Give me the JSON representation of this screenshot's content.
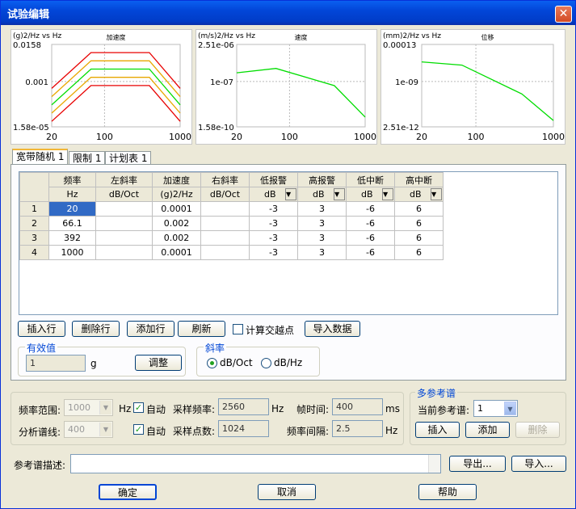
{
  "window": {
    "title": "试验编辑",
    "close_glyph": "✕"
  },
  "charts": [
    {
      "ylabel": "(g)2/Hz vs Hz",
      "title": "加速度",
      "y_top": "0.0158",
      "y_mid": "0.001",
      "y_bot": "1.58e-05",
      "x_ticks": [
        "20",
        "100",
        "1000"
      ]
    },
    {
      "ylabel": "(m/s)2/Hz vs Hz",
      "title": "速度",
      "y_top": "2.51e-06",
      "y_mid": "1e-07",
      "y_bot": "1.58e-10",
      "x_ticks": [
        "20",
        "100",
        "1000"
      ]
    },
    {
      "ylabel": "(mm)2/Hz vs Hz",
      "title": "位移",
      "y_top": "0.00013",
      "y_mid": "1e-09",
      "y_bot": "2.51e-12",
      "x_ticks": [
        "20",
        "100",
        "1000"
      ]
    }
  ],
  "chart_data": [
    {
      "type": "line",
      "x": [
        20,
        66.1,
        392,
        1000
      ],
      "title": "加速度",
      "xlabel": "",
      "ylabel": "(g)2/Hz vs Hz",
      "series": [
        {
          "values": [
            0.0001,
            0.002,
            0.002,
            0.0001
          ]
        }
      ],
      "colors": {
        "profile": "#00dd00",
        "warning": "#e8a800",
        "abort": "#e80000"
      }
    },
    {
      "type": "line",
      "x": [
        20,
        66.1,
        392,
        1000
      ],
      "title": "速度",
      "series": [
        {
          "values": [
            9e-08,
            1.5e-07,
            2e-08,
            5e-10
          ]
        }
      ]
    },
    {
      "type": "line",
      "x": [
        20,
        66.1,
        392,
        1000
      ],
      "title": "位移",
      "series": [
        {
          "values": [
            3e-06,
            1.5e-06,
            3e-09,
            1e-11
          ]
        }
      ]
    }
  ],
  "tabs": [
    {
      "label": "宽带随机 1"
    },
    {
      "label": "限制 1"
    },
    {
      "label": "计划表 1"
    }
  ],
  "table": {
    "headers": [
      "频率",
      "左斜率",
      "加速度",
      "右斜率",
      "低报警",
      "高报警",
      "低中断",
      "高中断"
    ],
    "units": [
      "Hz",
      "dB/Oct",
      "(g)2/Hz",
      "dB/Oct",
      "dB",
      "dB",
      "dB",
      "dB"
    ],
    "rows": [
      {
        "n": "1",
        "cells": [
          "20",
          "",
          "0.0001",
          "",
          "-3",
          "3",
          "-6",
          "6"
        ]
      },
      {
        "n": "2",
        "cells": [
          "66.1",
          "",
          "0.002",
          "",
          "-3",
          "3",
          "-6",
          "6"
        ]
      },
      {
        "n": "3",
        "cells": [
          "392",
          "",
          "0.002",
          "",
          "-3",
          "3",
          "-6",
          "6"
        ]
      },
      {
        "n": "4",
        "cells": [
          "1000",
          "",
          "0.0001",
          "",
          "-3",
          "3",
          "-6",
          "6"
        ]
      }
    ],
    "dropdown_glyph": "▼"
  },
  "toolbar": {
    "insert_row": "插入行",
    "delete_row": "删除行",
    "add_row": "添加行",
    "refresh": "刷新",
    "calc_cross": "计算交越点",
    "import_data": "导入数据"
  },
  "rms": {
    "group": "有效值",
    "value": "1",
    "unit": "g",
    "adjust": "调整"
  },
  "slope": {
    "group": "斜率",
    "opt1": "dB/Oct",
    "opt2": "dB/Hz"
  },
  "params": {
    "freq_range_label": "频率范围:",
    "freq_range_value": "1000",
    "hz": "Hz",
    "auto": "自动",
    "sample_rate_label": "采样频率:",
    "sample_rate_value": "2560",
    "hz2": "Hz",
    "frame_time_label": "帧时间:",
    "frame_time_value": "400",
    "ms": "ms",
    "lines_label": "分析谱线:",
    "lines_value": "400",
    "auto2": "自动",
    "sample_pts_label": "采样点数:",
    "sample_pts_value": "1024",
    "freq_int_label": "频率间隔:",
    "freq_int_value": "2.5",
    "hz3": "Hz",
    "check": "✓",
    "dd": "▼"
  },
  "multiref": {
    "group": "多参考谱",
    "current_label": "当前参考谱:",
    "current_value": "1",
    "insert": "插入",
    "add": "添加",
    "delete": "删除"
  },
  "refdesc": {
    "label": "参考谱描述:",
    "value": "",
    "export": "导出...",
    "import": "导入..."
  },
  "footer": {
    "ok": "确定",
    "cancel": "取消",
    "help": "帮助"
  }
}
